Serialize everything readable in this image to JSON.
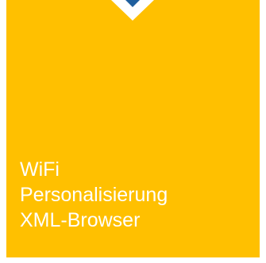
{
  "tile": {
    "background_color": "#FFC000",
    "notch_color": "#1F5F9E",
    "text_color": "#FFFFFF"
  },
  "features": [
    {
      "label": "WiFi"
    },
    {
      "label": "Personalisierung"
    },
    {
      "label": "XML-Browser"
    }
  ]
}
